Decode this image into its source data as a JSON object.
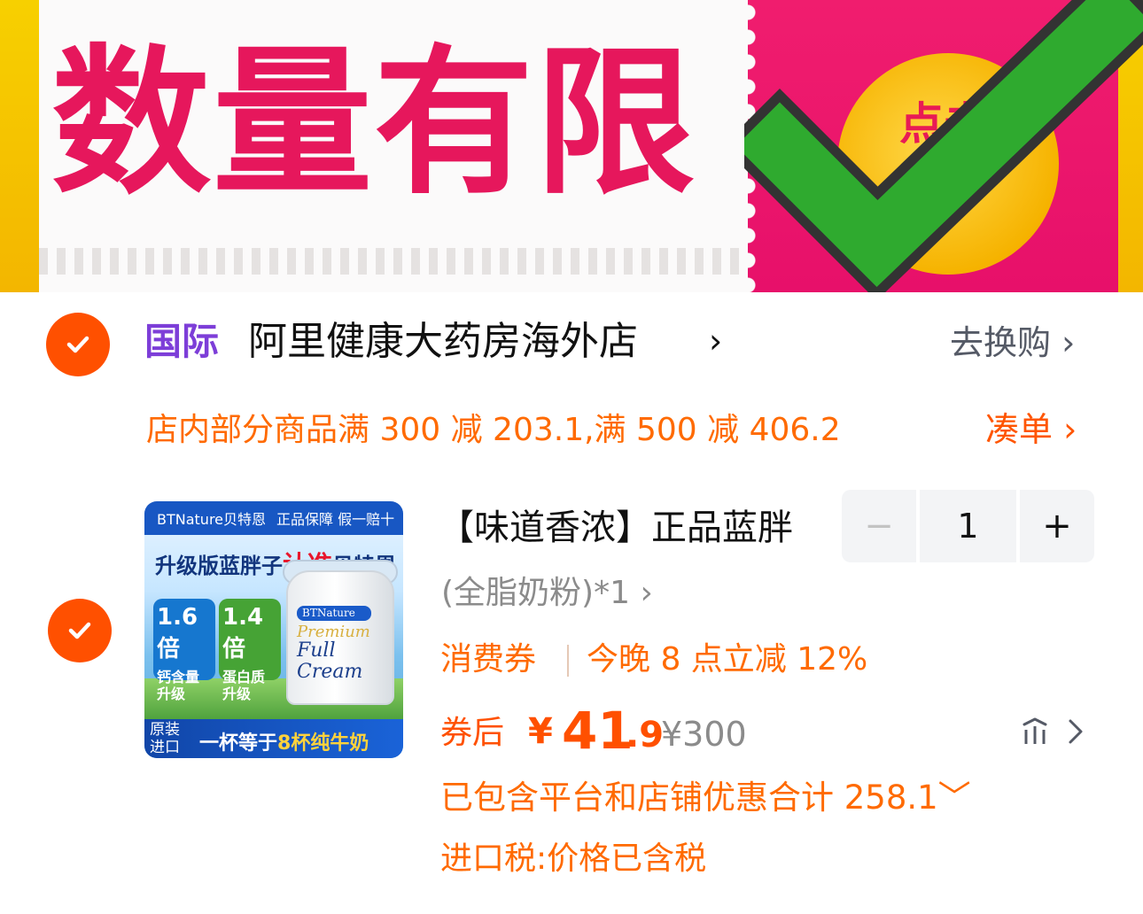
{
  "banner": {
    "title": "数量有限",
    "coin_text": "点击",
    "colors": {
      "banner_pink": "#e7106a",
      "banner_yellow": "#f3b600",
      "check_green": "#2faa2f"
    }
  },
  "store": {
    "tag": "国际",
    "name": "阿里健康大药房海外店",
    "name_chevron": "›",
    "exchange_label": "去换购",
    "exchange_chevron": "›",
    "promo_text": "店内部分商品满 300 减 203.1,满 500 减 406.2",
    "coudan_label": "凑单",
    "coudan_chevron": "›"
  },
  "product": {
    "image": {
      "brand_line": "BTNature贝特恩",
      "guarantee": "正品保障 假一赔十",
      "slogan_pre": "升级版蓝胖子",
      "slogan_red": "认准",
      "slogan_post": "贝特恩",
      "badge1_big": "1.6倍",
      "badge1_small": "钙含量升级",
      "badge2_big": "1.4倍",
      "badge2_small": "蛋白质升级",
      "can_brand": "BTNature",
      "can_line1": "Premium",
      "can_line2": "Full Cream",
      "origin": "原装进口",
      "bottom_pre": "一杯等于",
      "bottom_hl": "8杯纯牛奶"
    },
    "title": "【味道香浓】正品蓝胖",
    "spec": "(全脂奶粉)*1 ›",
    "coupon_label": "消费券",
    "coupon_text": "今晚 8 点立减 12%",
    "after_coupon_label": "券后",
    "currency": "¥",
    "price_int": "41",
    "price_dec": ".9",
    "original_price": "¥300",
    "discount_text": "已包含平台和店铺优惠合计 258.1﹀",
    "tax_text": "进口税:价格已含税",
    "quantity": "1",
    "minus_label": "−",
    "plus_label": "+"
  },
  "colors": {
    "accent_orange": "#ff5000",
    "promo_orange": "#ff6a00",
    "tag_purple": "#7d3ed8"
  }
}
